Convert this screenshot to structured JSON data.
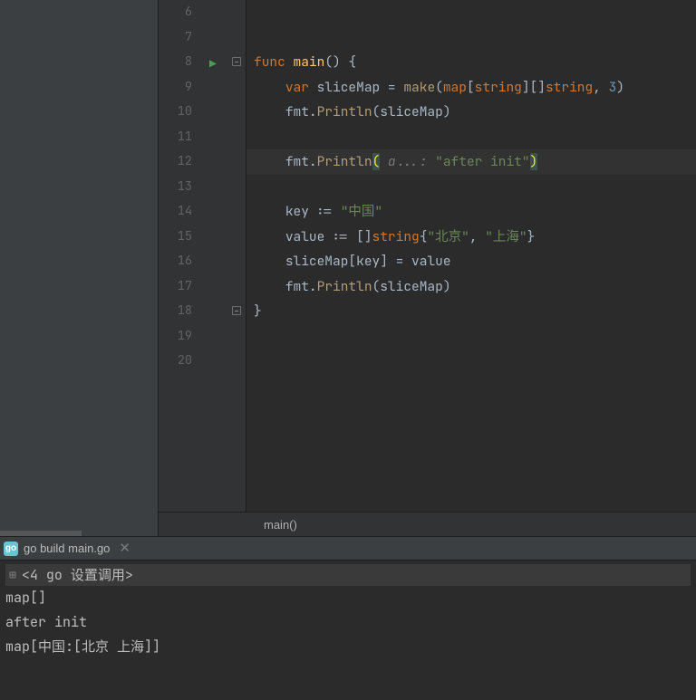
{
  "colors": {
    "kw": "#cc7832",
    "fn_def": "#ffc66d",
    "fn": "#b09d79",
    "typ": "#cc7832",
    "num": "#6897bb",
    "str": "#6a8759",
    "hint": "#787878"
  },
  "tab": {
    "icon_label": "go",
    "title": "go build main.go",
    "close_label": "✕"
  },
  "breadcrumb": "main()",
  "gutter": {
    "start": 6,
    "end": 20,
    "active": 12,
    "run_marker_line": 8,
    "fold_open_line": 8,
    "fold_close_line": 18,
    "lines": [
      "6",
      "7",
      "8",
      "9",
      "10",
      "11",
      "12",
      "13",
      "14",
      "15",
      "16",
      "17",
      "18",
      "19",
      "20"
    ]
  },
  "code_lines": {
    "6": [],
    "7": [],
    "8": [
      {
        "c": "kw",
        "t": "func "
      },
      {
        "c": "fn-def",
        "t": "main"
      },
      {
        "c": "paren",
        "t": "()"
      },
      {
        "c": "op",
        "t": " {"
      }
    ],
    "9": [
      {
        "c": "op",
        "t": "    "
      },
      {
        "c": "kw",
        "t": "var "
      },
      {
        "c": "ident",
        "t": "sliceMap"
      },
      {
        "c": "op",
        "t": " = "
      },
      {
        "c": "fn",
        "t": "make"
      },
      {
        "c": "paren",
        "t": "("
      },
      {
        "c": "kw",
        "t": "map"
      },
      {
        "c": "paren",
        "t": "["
      },
      {
        "c": "typ",
        "t": "string"
      },
      {
        "c": "paren",
        "t": "][]"
      },
      {
        "c": "typ",
        "t": "string"
      },
      {
        "c": "op",
        "t": ", "
      },
      {
        "c": "num",
        "t": "3"
      },
      {
        "c": "paren",
        "t": ")"
      }
    ],
    "10": [
      {
        "c": "op",
        "t": "    "
      },
      {
        "c": "ident",
        "t": "fmt"
      },
      {
        "c": "op",
        "t": "."
      },
      {
        "c": "fn",
        "t": "Println"
      },
      {
        "c": "paren",
        "t": "("
      },
      {
        "c": "ident",
        "t": "sliceMap"
      },
      {
        "c": "paren",
        "t": ")"
      }
    ],
    "11": [],
    "12": [
      {
        "c": "op",
        "t": "    "
      },
      {
        "c": "ident",
        "t": "fmt"
      },
      {
        "c": "op",
        "t": "."
      },
      {
        "c": "fn",
        "t": "Println"
      },
      {
        "c": "br-hi",
        "t": "("
      },
      {
        "c": "hint",
        "t": " a...: "
      },
      {
        "c": "str",
        "t": "\"after init\""
      },
      {
        "c": "br-hi",
        "t": ")"
      }
    ],
    "13": [],
    "14": [
      {
        "c": "op",
        "t": "    "
      },
      {
        "c": "ident",
        "t": "key"
      },
      {
        "c": "op",
        "t": " := "
      },
      {
        "c": "str",
        "t": "\"中国\""
      }
    ],
    "15": [
      {
        "c": "op",
        "t": "    "
      },
      {
        "c": "ident",
        "t": "value"
      },
      {
        "c": "op",
        "t": " := []"
      },
      {
        "c": "typ",
        "t": "string"
      },
      {
        "c": "paren",
        "t": "{"
      },
      {
        "c": "str",
        "t": "\"北京\""
      },
      {
        "c": "op",
        "t": ", "
      },
      {
        "c": "str",
        "t": "\"上海\""
      },
      {
        "c": "paren",
        "t": "}"
      }
    ],
    "16": [
      {
        "c": "op",
        "t": "    "
      },
      {
        "c": "ident",
        "t": "sliceMap"
      },
      {
        "c": "paren",
        "t": "["
      },
      {
        "c": "ident",
        "t": "key"
      },
      {
        "c": "paren",
        "t": "]"
      },
      {
        "c": "op",
        "t": " = "
      },
      {
        "c": "ident",
        "t": "value"
      }
    ],
    "17": [
      {
        "c": "op",
        "t": "    "
      },
      {
        "c": "ident",
        "t": "fmt"
      },
      {
        "c": "op",
        "t": "."
      },
      {
        "c": "fn",
        "t": "Println"
      },
      {
        "c": "paren",
        "t": "("
      },
      {
        "c": "ident",
        "t": "sliceMap"
      },
      {
        "c": "paren",
        "t": ")"
      }
    ],
    "18": [
      {
        "c": "op",
        "t": "}"
      }
    ],
    "19": [],
    "20": []
  },
  "console": {
    "command": "<4 go 设置调用>",
    "output": [
      "map[]",
      "after init",
      "map[中国:[北京 上海]]"
    ]
  }
}
